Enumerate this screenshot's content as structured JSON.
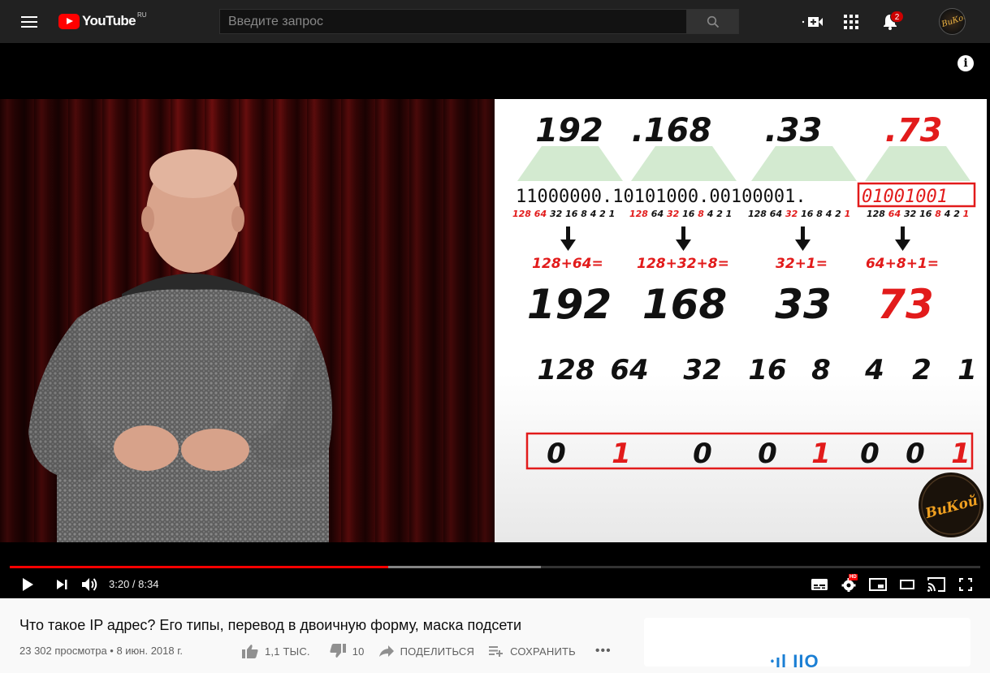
{
  "header": {
    "logo_text": "YouTube",
    "logo_country": "RU",
    "search_placeholder": "Введите запрос",
    "notifications_count": "2",
    "avatar_text": "ВиКой"
  },
  "slide": {
    "octets": [
      ".168",
      ".33",
      ".73"
    ],
    "octet_first": "192",
    "binary_line": "11000000.10101000.00100001.",
    "binary_last": "01001001",
    "weights": [
      "128",
      "64",
      "32",
      "16",
      "8",
      "4",
      "2",
      "1"
    ],
    "sums": [
      "128+64=",
      "128+32+8=",
      "32+1=",
      "64+8+1="
    ],
    "results": [
      "192",
      "168",
      "33",
      "73"
    ],
    "weights_big": [
      "128",
      "64",
      "32",
      "16",
      "8",
      "4",
      "2",
      "1"
    ],
    "bits": [
      "0",
      "1",
      "0",
      "0",
      "1",
      "0",
      "0",
      "1"
    ],
    "watermark": "ВиКой"
  },
  "player": {
    "time": "3:20 / 8:34",
    "hd_label": "HD",
    "played_fraction": 0.39,
    "loaded_fraction": 0.547
  },
  "video": {
    "title": "Что такое IP адрес? Его типы, перевод в двоичную форму, маска подсети",
    "meta": "23 302 просмотра • 8 июн. 2018 г.",
    "likes": "1,1 ТЫС.",
    "dislikes": "10",
    "share": "ПОДЕЛИТЬСЯ",
    "save": "СОХРАНИТЬ",
    "more": "•••"
  },
  "colors": {
    "accent": "#ff0000",
    "highlight": "#e21b1b",
    "trapezoid": "#d3ead0"
  }
}
